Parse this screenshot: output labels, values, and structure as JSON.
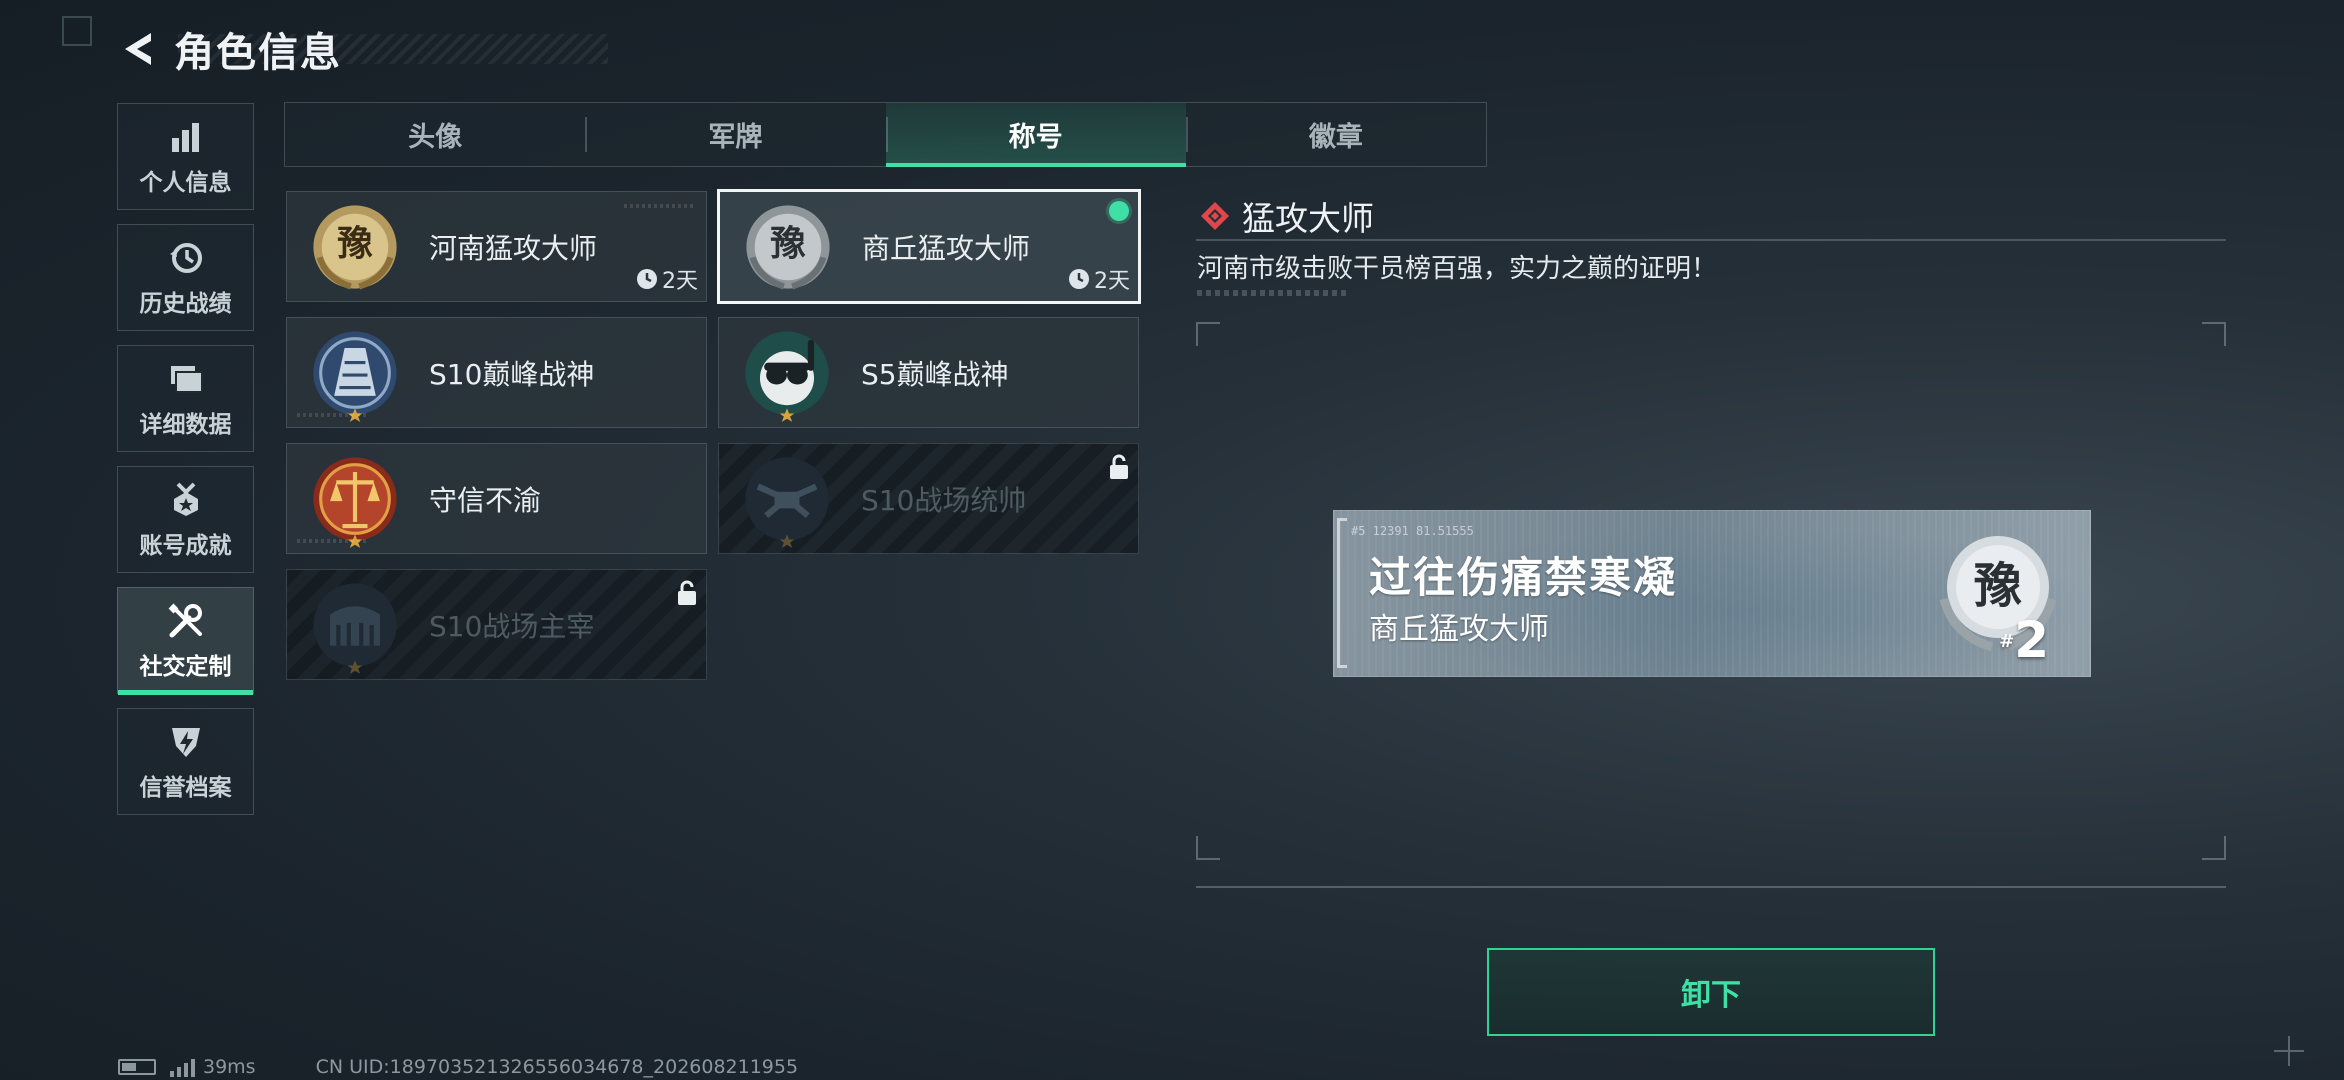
{
  "header": {
    "title": "角色信息"
  },
  "sidebar": {
    "items": [
      {
        "label": "个人信息",
        "icon": "bar-chart-icon",
        "active": false
      },
      {
        "label": "历史战绩",
        "icon": "history-clock-icon",
        "active": false
      },
      {
        "label": "详细数据",
        "icon": "folder-icon",
        "active": false
      },
      {
        "label": "账号成就",
        "icon": "medal-icon",
        "active": false
      },
      {
        "label": "社交定制",
        "icon": "wrench-screwdriver-icon",
        "active": true
      },
      {
        "label": "信誉档案",
        "icon": "shield-bolt-icon",
        "active": false
      }
    ]
  },
  "tabs": [
    {
      "label": "头像",
      "active": false
    },
    {
      "label": "军牌",
      "active": false
    },
    {
      "label": "称号",
      "active": true
    },
    {
      "label": "徽章",
      "active": false
    }
  ],
  "titles": [
    {
      "name": "河南猛攻大师",
      "timer": "2天",
      "state": "normal",
      "emblem": "gold-laurel-yu-emblem"
    },
    {
      "name": "商丘猛攻大师",
      "timer": "2天",
      "state": "selected-equipped",
      "emblem": "silver-laurel-yu-emblem"
    },
    {
      "name": "S10巅峰战神",
      "state": "normal",
      "emblem": "blue-tower-emblem"
    },
    {
      "name": "S5巅峰战神",
      "state": "normal",
      "emblem": "skull-diver-emblem"
    },
    {
      "name": "守信不渝",
      "state": "normal",
      "emblem": "justice-scale-emblem"
    },
    {
      "name": "S10战场统帅",
      "state": "locked",
      "emblem": "dark-drone-emblem"
    },
    {
      "name": "S10战场主宰",
      "state": "locked",
      "emblem": "dark-colosseum-emblem"
    }
  ],
  "detail": {
    "title": "猛攻大师",
    "description": "河南市级击败干员榜百强，实力之巅的证明！"
  },
  "preview": {
    "main_text": "过往伤痛禁寒凝",
    "sub_text": "商丘猛攻大师",
    "code_text": "#5 12391 81.51555",
    "rank_prefix": "#",
    "rank": "2"
  },
  "actions": {
    "unequip_label": "卸下"
  },
  "footer": {
    "ping": "39ms",
    "uid": "CN UID:18970352132655603467­8_202608211955"
  },
  "colors": {
    "accent": "#3ee0a5",
    "equipped_dot": "#3ee0a5",
    "diamond": "#e0464a"
  }
}
